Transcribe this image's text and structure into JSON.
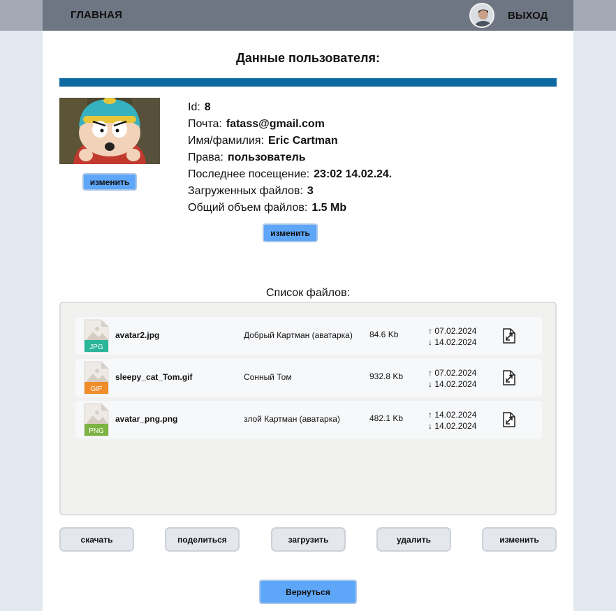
{
  "nav": {
    "home_label": "ГЛАВНАЯ",
    "logout_label": "ВЫХОД"
  },
  "page": {
    "title": "Данные пользователя:"
  },
  "profile": {
    "avatar_button": "изменить",
    "edit_button": "изменить",
    "fields": [
      {
        "label": "Id:",
        "value": "8"
      },
      {
        "label": "Почта:",
        "value": "fatass@gmail.com"
      },
      {
        "label": "Имя/фамилия:",
        "value": "Eric Cartman"
      },
      {
        "label": "Права:",
        "value": "пользователь"
      },
      {
        "label": "Последнее посещение:",
        "value": "23:02 14.02.24."
      },
      {
        "label": "Загруженных файлов:",
        "value": "3"
      },
      {
        "label": "Общий объем файлов:",
        "value": "1.5 Mb"
      }
    ]
  },
  "files": {
    "caption": "Список файлов:",
    "items": [
      {
        "ext": "JPG",
        "ext_color": "#2bb59a",
        "name": "avatar2.jpg",
        "description": "Добрый Картман (аватарка)",
        "size": "84.6 Kb",
        "uploaded": "↑ 07.02.2024",
        "downloaded": "↓ 14.02.2024"
      },
      {
        "ext": "GIF",
        "ext_color": "#f08c2a",
        "name": "sleepy_cat_Tom.gif",
        "description": "Сонный Том",
        "size": "932.8 Kb",
        "uploaded": "↑ 07.02.2024",
        "downloaded": "↓ 14.02.2024"
      },
      {
        "ext": "PNG",
        "ext_color": "#7cb342",
        "name": "avatar_png.png",
        "description": "злой Картман (аватарка)",
        "size": "482.1 Kb",
        "uploaded": "↑ 14.02.2024",
        "downloaded": "↓ 14.02.2024"
      }
    ]
  },
  "actions": {
    "download": "скачать",
    "share": "поделиться",
    "upload": "загрузить",
    "delete": "удалить",
    "edit": "изменить"
  },
  "back_button": "Вернуться",
  "colors": {
    "accent_strip": "#0d6aa1",
    "primary_button": "#5ea6f8",
    "header": "#6f7683"
  }
}
